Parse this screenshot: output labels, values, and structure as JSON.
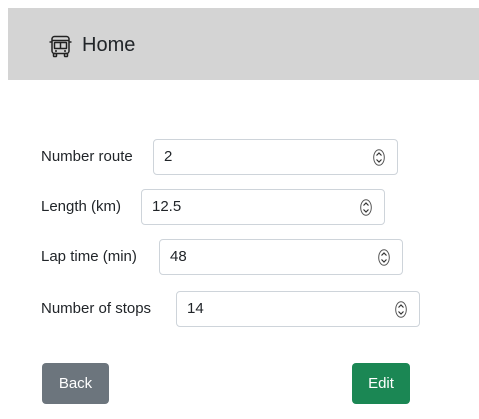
{
  "header": {
    "icon": "bus-icon",
    "title": "Home"
  },
  "form": {
    "fields": [
      {
        "label": "Number route",
        "value": "2"
      },
      {
        "label": "Length (km)",
        "value": "12.5"
      },
      {
        "label": "Lap time (min)",
        "value": "48"
      },
      {
        "label": "Number of stops",
        "value": "14"
      }
    ]
  },
  "actions": {
    "back_label": "Back",
    "edit_label": "Edit"
  },
  "colors": {
    "header_bg": "#d4d4d4",
    "back_button": "#6c757d",
    "edit_button": "#1b8754"
  }
}
